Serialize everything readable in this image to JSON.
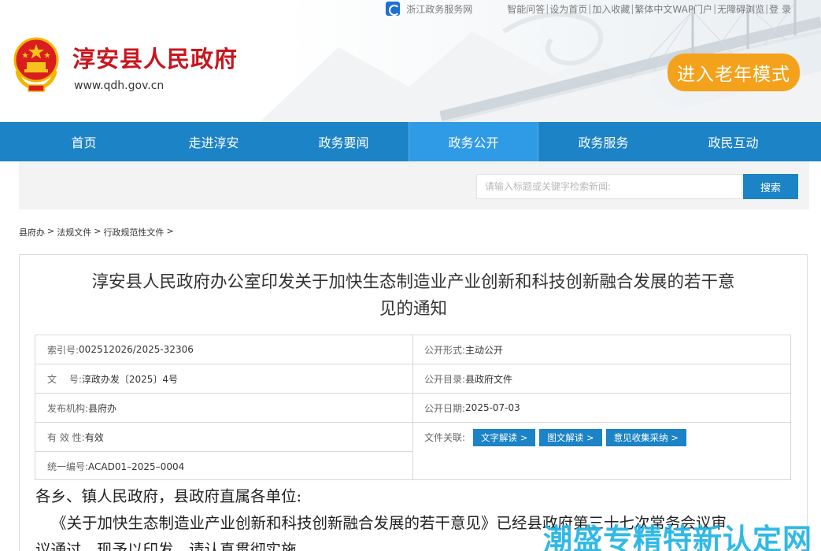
{
  "topbar": {
    "zj_service": "浙江政务服务网",
    "links": [
      "智能问答",
      "设为首页",
      "加入收藏",
      "繁体中文",
      "WAP门户",
      "无障碍浏览",
      "登 录"
    ]
  },
  "header": {
    "site_title": "淳安县人民政府",
    "site_domain": "www.qdh.gov.cn",
    "elder_mode": "进入老年模式"
  },
  "nav": {
    "items": [
      "首页",
      "走进淳安",
      "政务要闻",
      "政务公开",
      "政务服务",
      "政民互动"
    ],
    "active": "政务公开"
  },
  "search": {
    "placeholder": "请输入标题或关键字检索新闻:",
    "button": "搜索"
  },
  "breadcrumb": [
    "县府办",
    "法规文件",
    "行政规范性文件"
  ],
  "article": {
    "title_line1": "淳安县人民政府办公室印发关于加快生态制造业产业创新和科技创新融合发展的若干意",
    "title_line2": "见的通知",
    "meta_left": [
      {
        "label": "索引号:",
        "value": "002512026/2025-32306"
      },
      {
        "label": "文　 号:",
        "value": "淳政办发〔2025〕4号"
      },
      {
        "label": "发布机构:",
        "value": "县府办"
      },
      {
        "label": "有 效 性:",
        "value": "有效"
      },
      {
        "label": "统一编号:",
        "value": "ACAD01–2025–0004"
      }
    ],
    "meta_right": [
      {
        "label": "公开形式:",
        "value": "主动公开"
      },
      {
        "label": "公开目录:",
        "value": "县政府文件"
      },
      {
        "label": "公开日期:",
        "value": "2025-07-03"
      }
    ],
    "related_label": "文件关联:",
    "related_buttons": [
      "文字解读 >",
      "图文解读 >",
      "意见收集采纳 >"
    ],
    "salutation": "各乡、镇人民政府，县政府直属各单位:",
    "para1_line1": "《关于加快生态制造业产业创新和科技创新融合发展的若干意见》已经县政府第三十七次常务会议审",
    "para1_line2": "议通过，现予以印发，请认真贯彻实施。"
  },
  "watermark": "潮盛专精特新认定网",
  "colors": {
    "brand_blue": "#1b83c6",
    "active_nav": "#2f9ae6",
    "title_red": "#c9151e",
    "elder_orange": "#f4a21b",
    "watermark": "#27b6e4"
  }
}
